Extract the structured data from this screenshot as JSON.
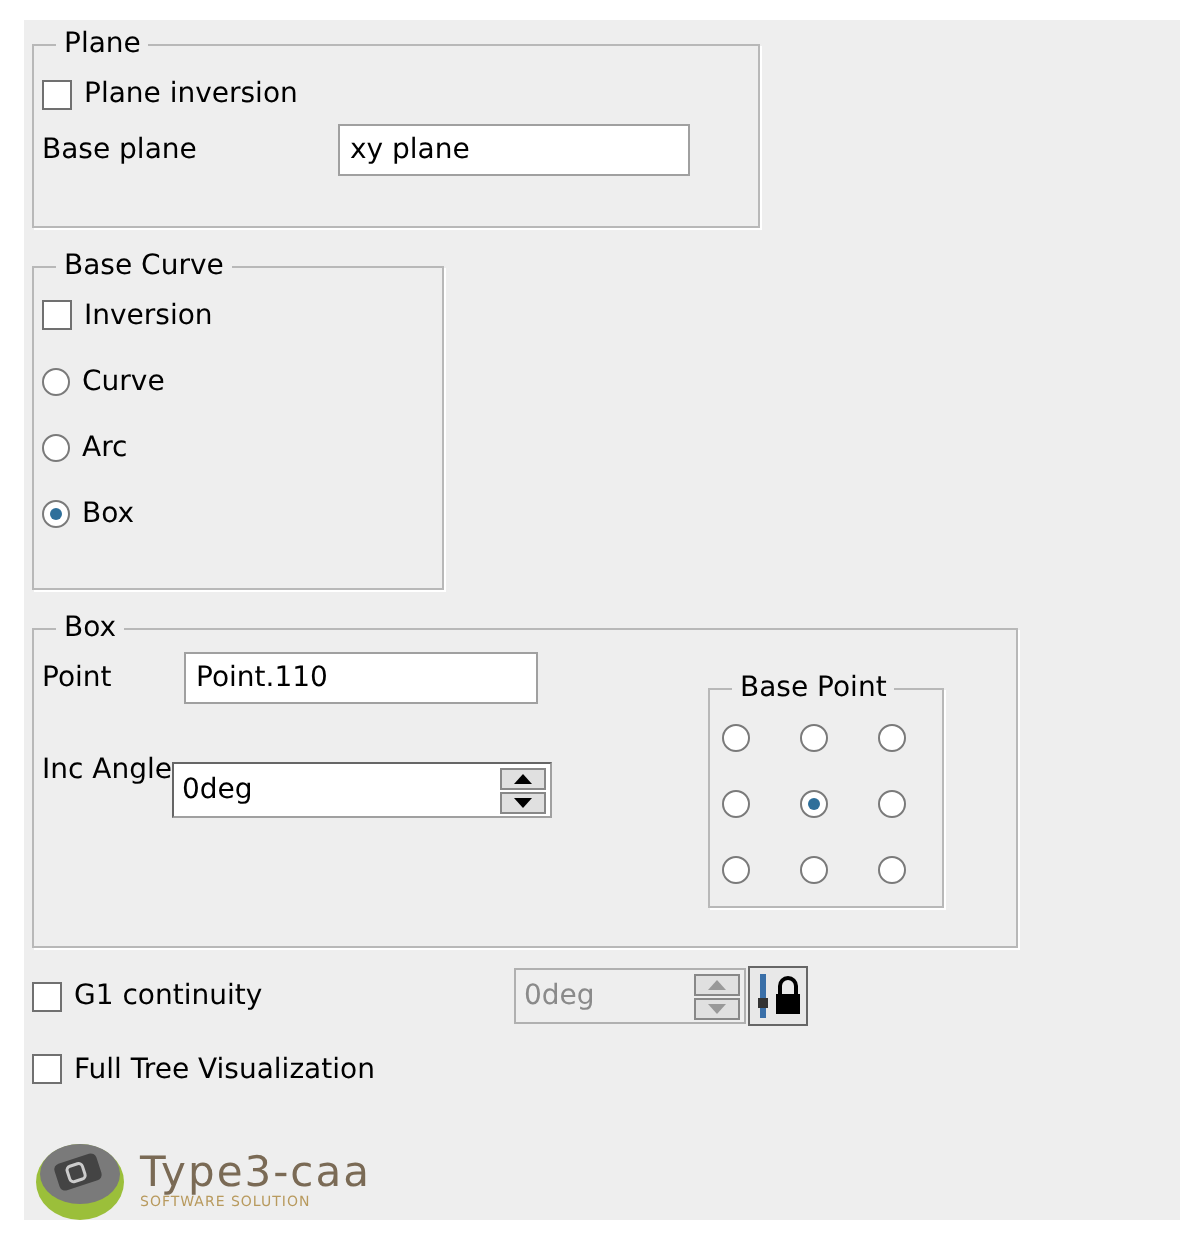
{
  "plane": {
    "title": "Plane",
    "inversion": {
      "label": "Plane inversion",
      "checked": false
    },
    "base_plane": {
      "label": "Base plane",
      "value": "xy plane"
    }
  },
  "base_curve": {
    "title": "Base Curve",
    "inversion": {
      "label": "Inversion",
      "checked": false
    },
    "options": [
      {
        "label": "Curve",
        "selected": false
      },
      {
        "label": "Arc",
        "selected": false
      },
      {
        "label": "Box",
        "selected": true
      }
    ]
  },
  "box": {
    "title": "Box",
    "point": {
      "label": "Point",
      "value": "Point.110"
    },
    "inc_angle": {
      "label": "Inc Angle",
      "value": "0deg"
    },
    "base_point": {
      "title": "Base Point",
      "options": [
        {
          "selected": false
        },
        {
          "selected": false
        },
        {
          "selected": false
        },
        {
          "selected": false
        },
        {
          "selected": true
        },
        {
          "selected": false
        },
        {
          "selected": false
        },
        {
          "selected": false
        },
        {
          "selected": false
        }
      ]
    }
  },
  "g1_continuity": {
    "label": "G1 continuity",
    "checked": false,
    "value": "0deg",
    "disabled": true
  },
  "full_tree": {
    "label": "Full Tree Visualization",
    "checked": false
  },
  "logo": {
    "name": "Type3-caa",
    "tagline": "SOFTWARE SOLUTION"
  }
}
